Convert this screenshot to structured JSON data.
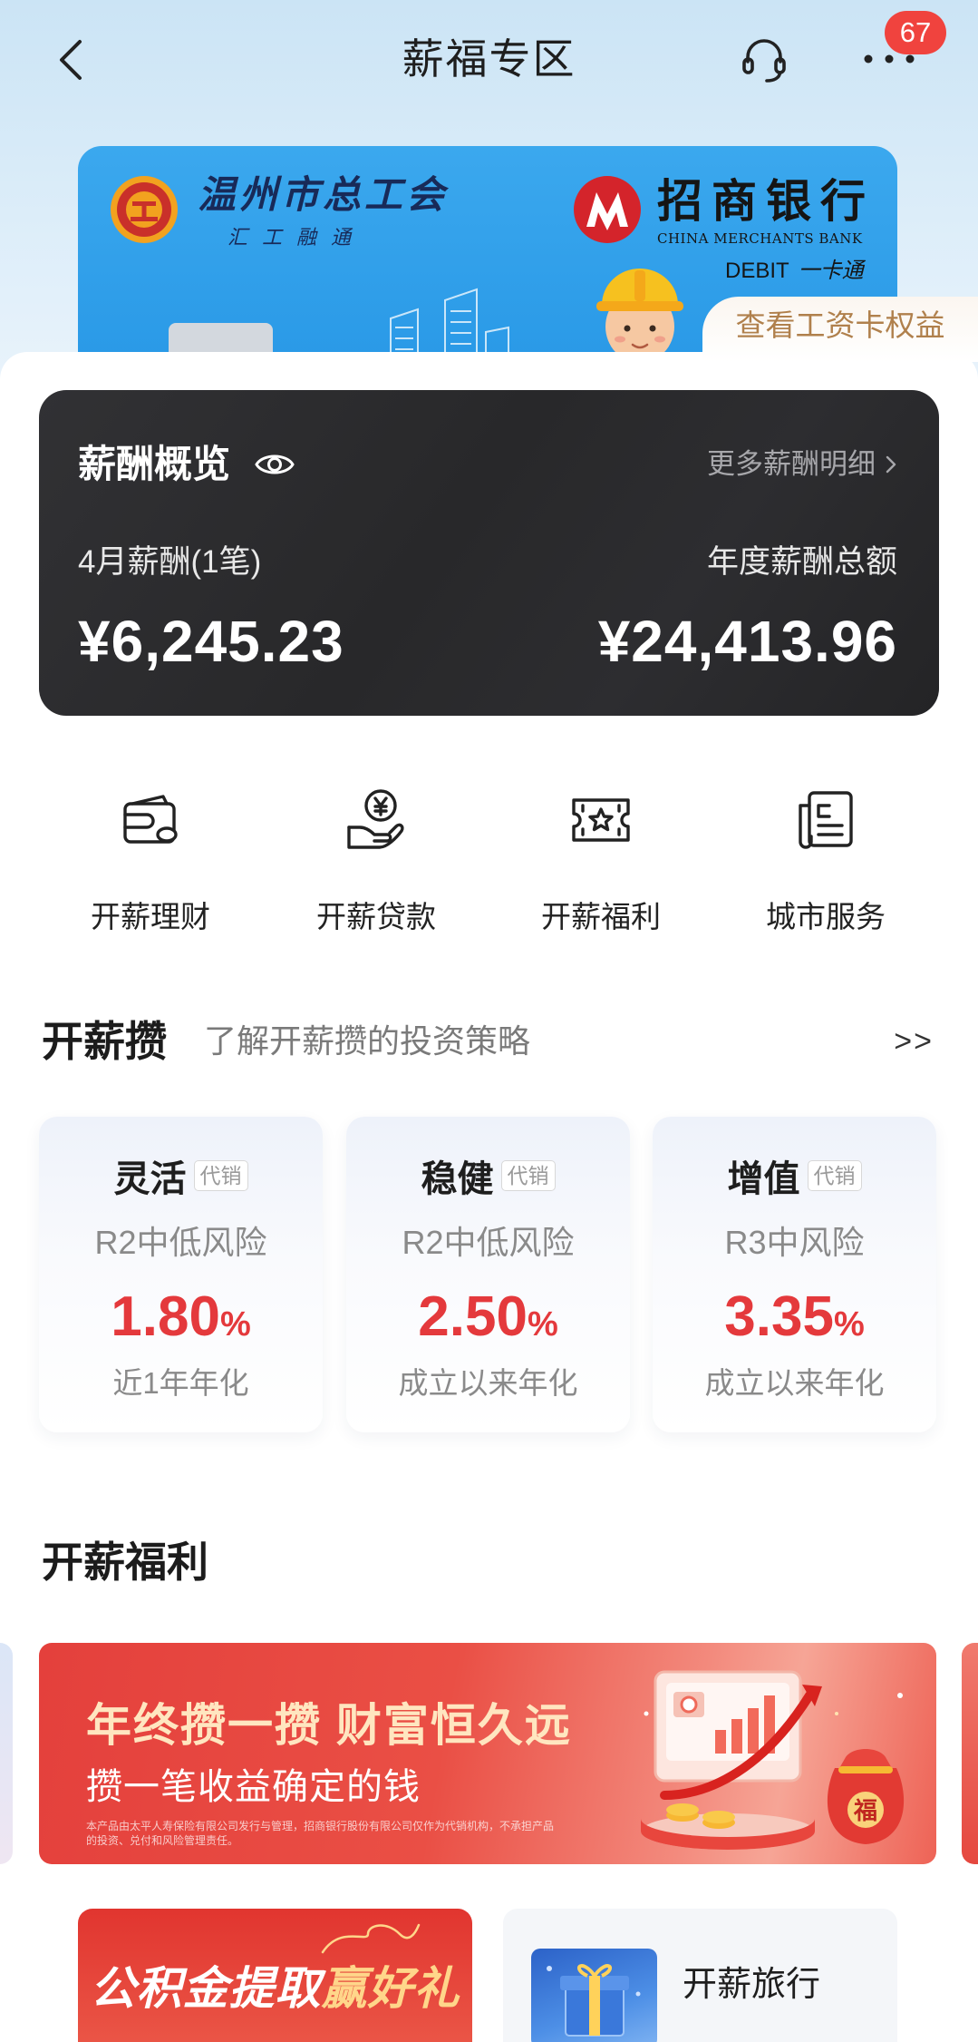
{
  "header": {
    "title": "薪福专区",
    "back_icon": "chevron-left-icon",
    "service_icon": "headset-icon",
    "more_icon": "more-dots-icon",
    "badge": "67"
  },
  "card": {
    "union_name": "温州市总工会",
    "union_slogan": "汇工融通",
    "bank_name": "招商银行",
    "bank_name_en": "CHINA MERCHANTS BANK",
    "card_type": "DEBIT",
    "card_product": "一卡通",
    "benefits_link": "查看工资卡权益"
  },
  "salary": {
    "title": "薪酬概览",
    "visibility_icon": "eye-icon",
    "more_link": "更多薪酬明细",
    "month_label": "4月薪酬(1笔)",
    "month_amount": "¥6,245.23",
    "annual_label": "年度薪酬总额",
    "annual_amount": "¥24,413.96"
  },
  "services": [
    {
      "label": "开薪理财",
      "icon": "wallet-icon"
    },
    {
      "label": "开薪贷款",
      "icon": "yen-hand-icon"
    },
    {
      "label": "开薪福利",
      "icon": "star-ticket-icon"
    },
    {
      "label": "城市服务",
      "icon": "document-icon"
    }
  ],
  "savings": {
    "title": "开薪攒",
    "subtitle": "了解开薪攒的投资策略",
    "more": ">>",
    "products": [
      {
        "name": "灵活",
        "tag": "代销",
        "risk": "R2中低风险",
        "rate": "1.80",
        "unit": "%",
        "rate_label": "近1年年化"
      },
      {
        "name": "稳健",
        "tag": "代销",
        "risk": "R2中低风险",
        "rate": "2.50",
        "unit": "%",
        "rate_label": "成立以来年化"
      },
      {
        "name": "增值",
        "tag": "代销",
        "risk": "R3中风险",
        "rate": "3.35",
        "unit": "%",
        "rate_label": "成立以来年化"
      }
    ]
  },
  "benefits": {
    "title": "开薪福利",
    "banner": {
      "headline": "年终攒一攒 财富恒久远",
      "subline": "攒一笔收益确定的钱",
      "disclaimer": "本产品由太平人寿保险有限公司发行与管理，招商银行股份有限公司仅作为代销机构，不承担产品的投资、兑付和风险管理责任。",
      "bag_char": "福"
    }
  },
  "promos": {
    "left": {
      "title_main": "公积金提取",
      "title_highlight": "赢好礼"
    },
    "right": {
      "title": "开薪旅行"
    }
  },
  "colors": {
    "accent_red": "#e4393c",
    "dark_card": "#2a2a2d",
    "card_blue": "#2f9de9",
    "badge_red": "#f0433e",
    "benefit_tab_text": "#b0804c"
  }
}
